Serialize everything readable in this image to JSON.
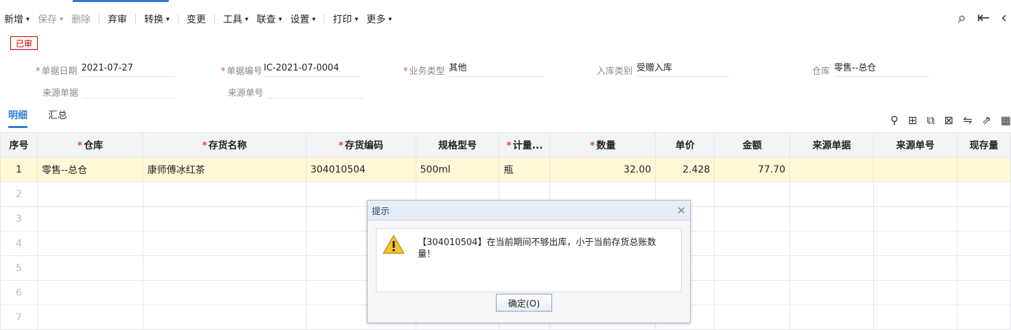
{
  "toolbar": {
    "items": [
      {
        "label": "新增",
        "chev": "⌄"
      },
      {
        "label": "保存",
        "chev": "⌄"
      },
      {
        "label": "删除"
      },
      {
        "label": "弃审"
      },
      {
        "label": "转换",
        "chev": "⌄"
      },
      {
        "label": "变更"
      },
      {
        "label": "工具",
        "chev": "⌄"
      },
      {
        "label": "联查",
        "chev": "⌄"
      },
      {
        "label": "设置",
        "chev": "⌄"
      },
      {
        "label": "打印",
        "chev": "⌄"
      },
      {
        "label": "更多",
        "chev": "⌄"
      }
    ],
    "right_icons": [
      "search-doc-icon",
      "first-page-icon",
      "prev-page-icon"
    ]
  },
  "status_badge": "已审",
  "form": {
    "doc_date_label": "单据日期",
    "doc_date_value": "2021-07-27",
    "doc_no_label": "单据编号",
    "doc_no_value": "IC-2021-07-0004",
    "biz_type_label": "业务类型",
    "biz_type_value": "其他",
    "in_type_label": "入库类别",
    "in_type_value": "受赠入库",
    "warehouse_label": "仓库",
    "warehouse_value": "零售--总仓",
    "source_doc_label": "来源单据",
    "source_doc_value": "",
    "source_no_label": "来源单号",
    "source_no_value": ""
  },
  "tabs": {
    "detail": "明细",
    "summary": "汇总"
  },
  "grid": {
    "headers": {
      "seq": "序号",
      "warehouse": "仓库",
      "item_name": "存货名称",
      "item_code": "存货编码",
      "spec": "规格型号",
      "unit": "计量...",
      "qty": "数量",
      "price": "单价",
      "amount": "金额",
      "source_doc": "来源单据",
      "source_no": "来源单号",
      "stock": "现存量"
    },
    "rows": [
      {
        "seq": "1",
        "warehouse": "零售--总仓",
        "item_name": "康师傅冰红茶",
        "item_code": "304010504",
        "spec": "500ml",
        "unit": "瓶",
        "qty": "32.00",
        "price": "2.428",
        "amount": "77.70"
      },
      {
        "seq": "2"
      },
      {
        "seq": "3"
      },
      {
        "seq": "4"
      },
      {
        "seq": "5"
      },
      {
        "seq": "6"
      },
      {
        "seq": "7"
      }
    ]
  },
  "dialog": {
    "title": "提示",
    "message": "【304010504】在当前期间不够出库，小于当前存货总账数量！",
    "ok_label": "确定(O)"
  }
}
